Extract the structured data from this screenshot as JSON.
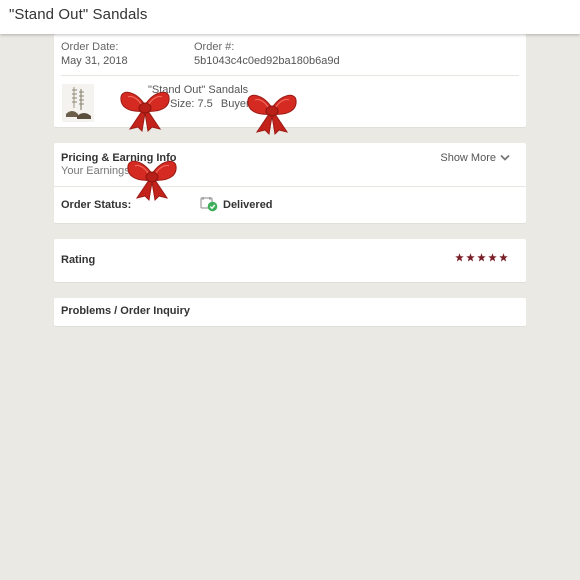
{
  "header": {
    "title": "\"Stand Out\" Sandals"
  },
  "order": {
    "date_label": "Order Date:",
    "date_value": "May 31, 2018",
    "number_label": "Order #:",
    "number_value": "5b1043c4c0ed92ba180b6a9d"
  },
  "item": {
    "name": "\"Stand Out\" Sandals",
    "size": "Size: 7.5",
    "buyer_label": "Buyer:"
  },
  "pricing": {
    "title": "Pricing & Earning Info",
    "earnings_label": "Your Earnings:",
    "show_more": "Show More"
  },
  "status": {
    "label": "Order Status:",
    "value": "Delivered",
    "icon": "delivered-check-icon"
  },
  "rating": {
    "label": "Rating",
    "stars": 5,
    "star_color": "#7a1f28"
  },
  "problems": {
    "label": "Problems / Order Inquiry"
  },
  "colors": {
    "background": "#ebe9e3",
    "card": "#ffffff",
    "bow": "#d42a21",
    "delivered": "#3dae5a"
  }
}
